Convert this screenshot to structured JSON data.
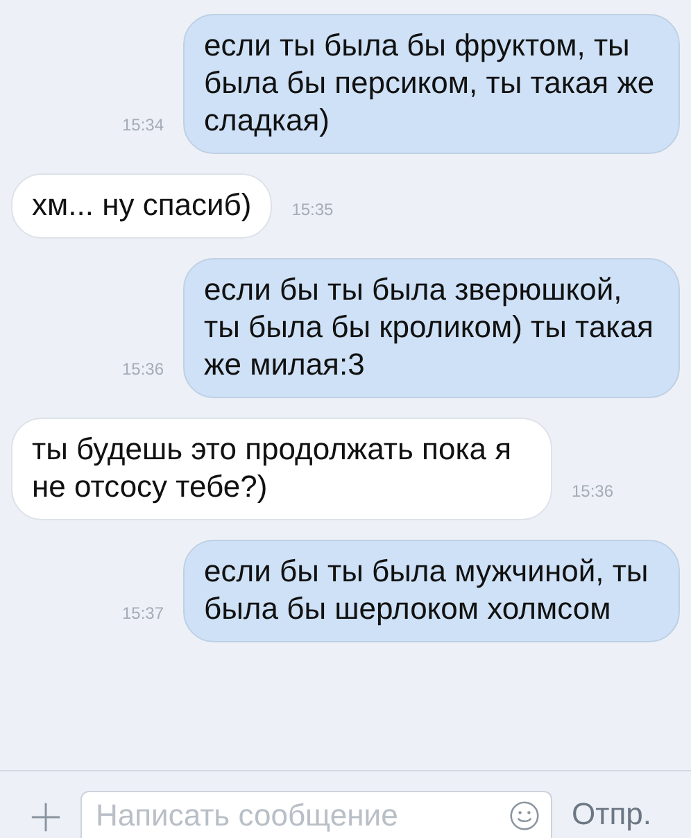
{
  "messages": [
    {
      "kind": "out",
      "text": "если ты была бы фруктом, ты была бы персиком, ты такая же сладкая)",
      "time": "15:34"
    },
    {
      "kind": "in",
      "text": "хм... ну спасиб)",
      "time": "15:35"
    },
    {
      "kind": "out",
      "text": "если бы ты была зверюшкой, ты была бы кроликом) ты такая же милая:3",
      "time": "15:36"
    },
    {
      "kind": "in",
      "text": "ты будешь это продолжать пока я не отсосу тебе?)",
      "time": "15:36"
    },
    {
      "kind": "out",
      "text": "если бы ты была мужчиной, ты была бы шерлоком холмсом",
      "time": "15:37"
    }
  ],
  "composer": {
    "placeholder": "Написать сообщение",
    "send": "Отпр."
  }
}
